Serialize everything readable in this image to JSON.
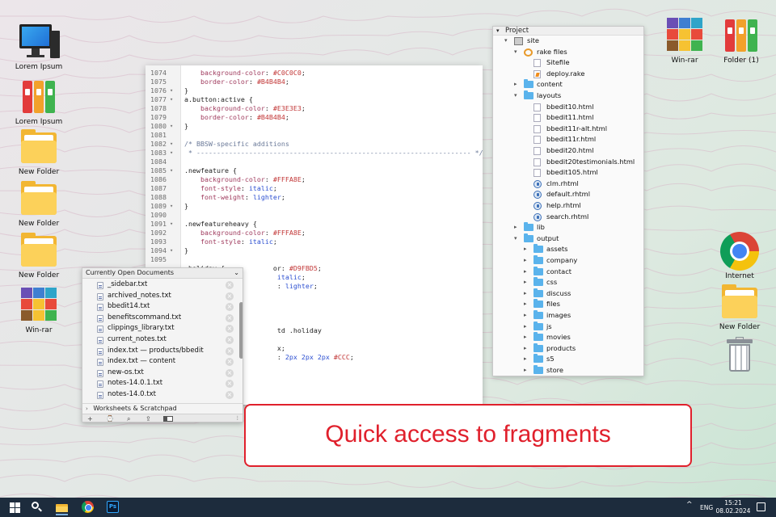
{
  "desktop_icons": {
    "pc": "Lorem Ipsum",
    "binders": "Lorem Ipsum",
    "folder_1": "New Folder",
    "folder_2": "New Folder",
    "folder_3": "New Folder",
    "winrar_left": "Win-rar",
    "winrar_right": "Win-rar",
    "folder_right": "Folder (1)",
    "internet": "Internet",
    "folder_new_right": "New Folder",
    "trash": ""
  },
  "editor": {
    "lines": [
      {
        "n": "1074",
        "fold": "",
        "code": "    background-color: #C0C0C0;"
      },
      {
        "n": "1075",
        "fold": "",
        "code": "    border-color: #B4B4B4;"
      },
      {
        "n": "1076",
        "fold": "▾",
        "code": "}"
      },
      {
        "n": "1077",
        "fold": "▾",
        "code": "a.button:active {"
      },
      {
        "n": "1078",
        "fold": "",
        "code": "    background-color: #E3E3E3;"
      },
      {
        "n": "1079",
        "fold": "",
        "code": "    border-color: #B4B4B4;"
      },
      {
        "n": "1080",
        "fold": "▾",
        "code": "}"
      },
      {
        "n": "1081",
        "fold": "",
        "code": ""
      },
      {
        "n": "1082",
        "fold": "▾",
        "code": "/* BBSW-specific additions"
      },
      {
        "n": "1083",
        "fold": "▾",
        "code": " * -------------------------------------------------------------------- */"
      },
      {
        "n": "1084",
        "fold": "",
        "code": ""
      },
      {
        "n": "1085",
        "fold": "▾",
        "code": ".newfeature {"
      },
      {
        "n": "1086",
        "fold": "",
        "code": "    background-color: #FFFA8E;"
      },
      {
        "n": "1087",
        "fold": "",
        "code": "    font-style: italic;"
      },
      {
        "n": "1088",
        "fold": "",
        "code": "    font-weight: lighter;"
      },
      {
        "n": "1089",
        "fold": "▾",
        "code": "}"
      },
      {
        "n": "1090",
        "fold": "",
        "code": ""
      },
      {
        "n": "1091",
        "fold": "▾",
        "code": ".newfeatureheavy {"
      },
      {
        "n": "1092",
        "fold": "",
        "code": "    background-color: #FFFA8E;"
      },
      {
        "n": "1093",
        "fold": "",
        "code": "    font-style: italic;"
      },
      {
        "n": "1094",
        "fold": "▾",
        "code": "}"
      },
      {
        "n": "1095",
        "fold": "",
        "code": ""
      },
      {
        "n": "",
        "fold": "",
        "code": ".holiday {            or: #D9FBD5;"
      },
      {
        "n": "",
        "fold": "",
        "code": "                       italic;"
      },
      {
        "n": "",
        "fold": "",
        "code": "                       : lighter;"
      },
      {
        "n": "",
        "fold": "",
        "code": ""
      },
      {
        "n": "",
        "fold": "",
        "code": ""
      },
      {
        "n": "",
        "fold": "",
        "code": ""
      },
      {
        "n": "",
        "fold": "",
        "code": ""
      },
      {
        "n": "",
        "fold": "",
        "code": "                       td .holiday"
      },
      {
        "n": "",
        "fold": "",
        "code": ""
      },
      {
        "n": "",
        "fold": "",
        "code": "                       x;"
      },
      {
        "n": "",
        "fold": "",
        "code": "                       : 2px 2px 2px #CCC;"
      }
    ]
  },
  "open_documents": {
    "title": "Currently Open Documents",
    "files": [
      "_sidebar.txt",
      "archived_notes.txt",
      "bbedit14.txt",
      "benefitscommand.txt",
      "clippings_library.txt",
      "current_notes.txt",
      "index.txt — products/bbedit",
      "index.txt — content",
      "new-os.txt",
      "notes-14.0.1.txt",
      "notes-14.0.txt"
    ],
    "worksheets": "Worksheets & Scratchpad",
    "tools": {
      "add": "+",
      "history": "⌚",
      "search": "⌕",
      "share": "⇪"
    }
  },
  "project": {
    "title": "Project",
    "items": [
      {
        "level": 0,
        "arrow": "▾",
        "icon": "site",
        "name": "site"
      },
      {
        "level": 1,
        "arrow": "▾",
        "icon": "rake",
        "name": "rake files"
      },
      {
        "level": 2,
        "arrow": "",
        "icon": "file",
        "name": "Sitefile"
      },
      {
        "level": 2,
        "arrow": "",
        "icon": "deploy",
        "name": "deploy.rake"
      },
      {
        "level": 1,
        "arrow": "▸",
        "icon": "folder",
        "name": "content"
      },
      {
        "level": 1,
        "arrow": "▾",
        "icon": "folder",
        "name": "layouts"
      },
      {
        "level": 2,
        "arrow": "",
        "icon": "file",
        "name": "bbedit10.html"
      },
      {
        "level": 2,
        "arrow": "",
        "icon": "file",
        "name": "bbedit11.html"
      },
      {
        "level": 2,
        "arrow": "",
        "icon": "file",
        "name": "bbedit11r-alt.html"
      },
      {
        "level": 2,
        "arrow": "",
        "icon": "file",
        "name": "bbedit11r.html"
      },
      {
        "level": 2,
        "arrow": "",
        "icon": "file",
        "name": "bbedit20.html"
      },
      {
        "level": 2,
        "arrow": "",
        "icon": "file",
        "name": "bbedit20testimonials.html"
      },
      {
        "level": 2,
        "arrow": "",
        "icon": "file",
        "name": "bbedit105.html"
      },
      {
        "level": 2,
        "arrow": "",
        "icon": "rb",
        "name": "clm.rhtml"
      },
      {
        "level": 2,
        "arrow": "",
        "icon": "rb",
        "name": "default.rhtml"
      },
      {
        "level": 2,
        "arrow": "",
        "icon": "rb",
        "name": "help.rhtml"
      },
      {
        "level": 2,
        "arrow": "",
        "icon": "rb",
        "name": "search.rhtml"
      },
      {
        "level": 1,
        "arrow": "▸",
        "icon": "folder",
        "name": "lib"
      },
      {
        "level": 1,
        "arrow": "▾",
        "icon": "folder",
        "name": "output"
      },
      {
        "level": 2,
        "arrow": "▸",
        "icon": "folder",
        "name": "assets"
      },
      {
        "level": 2,
        "arrow": "▸",
        "icon": "folder",
        "name": "company"
      },
      {
        "level": 2,
        "arrow": "▸",
        "icon": "folder",
        "name": "contact"
      },
      {
        "level": 2,
        "arrow": "▸",
        "icon": "folder",
        "name": "css"
      },
      {
        "level": 2,
        "arrow": "▸",
        "icon": "folder",
        "name": "discuss"
      },
      {
        "level": 2,
        "arrow": "▸",
        "icon": "folder",
        "name": "files"
      },
      {
        "level": 2,
        "arrow": "▸",
        "icon": "folder",
        "name": "images"
      },
      {
        "level": 2,
        "arrow": "▸",
        "icon": "folder",
        "name": "js"
      },
      {
        "level": 2,
        "arrow": "▸",
        "icon": "folder",
        "name": "movies"
      },
      {
        "level": 2,
        "arrow": "▸",
        "icon": "folder",
        "name": "products"
      },
      {
        "level": 2,
        "arrow": "▸",
        "icon": "folder",
        "name": "s5"
      },
      {
        "level": 2,
        "arrow": "▸",
        "icon": "folder",
        "name": "store"
      }
    ]
  },
  "callout": {
    "text": "Quick access to fragments"
  },
  "taskbar": {
    "apps": [
      "start-icon",
      "search-icon",
      "file-explorer-icon",
      "chrome-icon",
      "photoshop-icon"
    ],
    "photoshop_label": "Ps",
    "tray_arrow": "^",
    "language": "ENG",
    "time": "15:21",
    "date": "08.02.2024"
  },
  "colors": {
    "accent_red": "#e0202c",
    "taskbar": "#1d2c3d",
    "folder_blue": "#5ab3ec"
  }
}
